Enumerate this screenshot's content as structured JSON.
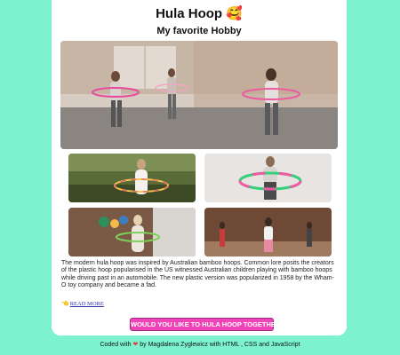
{
  "header": {
    "title": "Hula Hoop 🥰",
    "subtitle": "My favorite Hobby"
  },
  "images": {
    "hero": "hula-hoop-class-photo",
    "gallery": [
      "woman-with-hoop-outdoors-photo",
      "woman-with-colorful-hoop-photo",
      "woman-hooping-at-home-photo",
      "group-hooping-in-studio-photo"
    ]
  },
  "content": {
    "paragraph": "The modern hula hoop was inspired by Australian bamboo hoops. Common lore posits the creators of the plastic hoop popularised in the US witnessed Australian children playing with bamboo hoops while driving past in an automobile. The new plastic version was popularized in 1958 by the Wham-O toy company and became a fad.",
    "read_more": "READ MORE",
    "read_more_icon": "👈"
  },
  "cta": {
    "label": "WOULD YOU LIKE TO HULA HOOP TOGETHER?"
  },
  "footer": {
    "prefix": "Coded with",
    "heart": "❤",
    "suffix": "by Magdalena Zyglewicz with HTML , CSS and JavaScript"
  },
  "colors": {
    "background": "#7cf2cf",
    "cta": "#f043b8",
    "link": "#2b33a8"
  }
}
